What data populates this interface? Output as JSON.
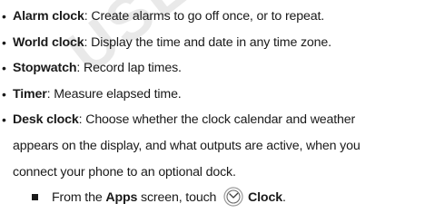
{
  "watermark": "USE ONLY",
  "items": [
    {
      "term": "Alarm clock",
      "desc": ": Create alarms to go off once, or to repeat."
    },
    {
      "term": "World clock",
      "desc": ": Display the time and date in any time zone."
    },
    {
      "term": "Stopwatch",
      "desc": ": Record lap times."
    },
    {
      "term": "Timer",
      "desc": ": Measure elapsed time."
    },
    {
      "term": "Desk clock",
      "desc": ": Choose whether the clock calendar and weather"
    }
  ],
  "desk_clock_continued": [
    "appears on the display, and what outputs are active, when you",
    "connect your phone to an optional dock."
  ],
  "step": {
    "prefix": "From the ",
    "apps": "Apps",
    "middle": " screen, touch",
    "clock_icon": "clock-icon",
    "clock": "Clock",
    "end": "."
  }
}
